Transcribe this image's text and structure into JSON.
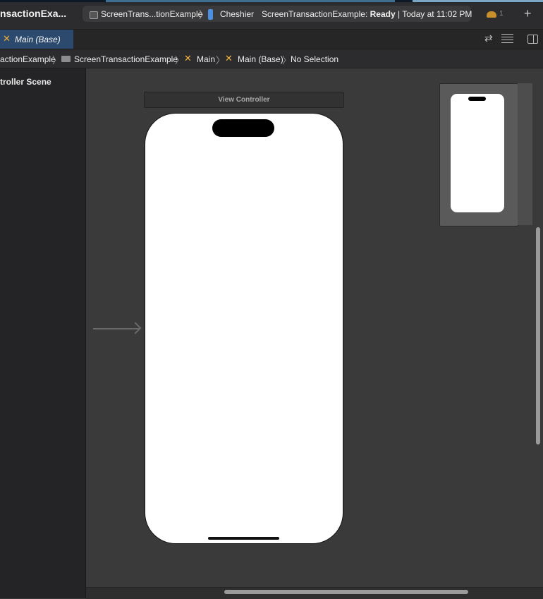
{
  "titlebar": {
    "project_title": "nsactionExa...",
    "scheme": "ScreenTrans...tionExample",
    "device": "Cheshier",
    "status_prefix": "ScreenTransactionExample: ",
    "status_state": "Ready",
    "status_suffix": " | Today at 11:02 PM",
    "warning_count": "1",
    "add_symbol": "+"
  },
  "tab": {
    "label": "Main (Base)",
    "icon": "storyboard-icon"
  },
  "breadcrumb": {
    "items": [
      "actionExample",
      "ScreenTransactionExample",
      "Main",
      "Main (Base)",
      "No Selection"
    ],
    "separator": "〉"
  },
  "outline": {
    "scene_label": "troller Scene"
  },
  "canvas": {
    "view_controller_title": "View Controller"
  },
  "colors": {
    "accent": "#2c4a6e",
    "storyboard": "#f3b23a",
    "device_blue": "#4a8fe0"
  }
}
